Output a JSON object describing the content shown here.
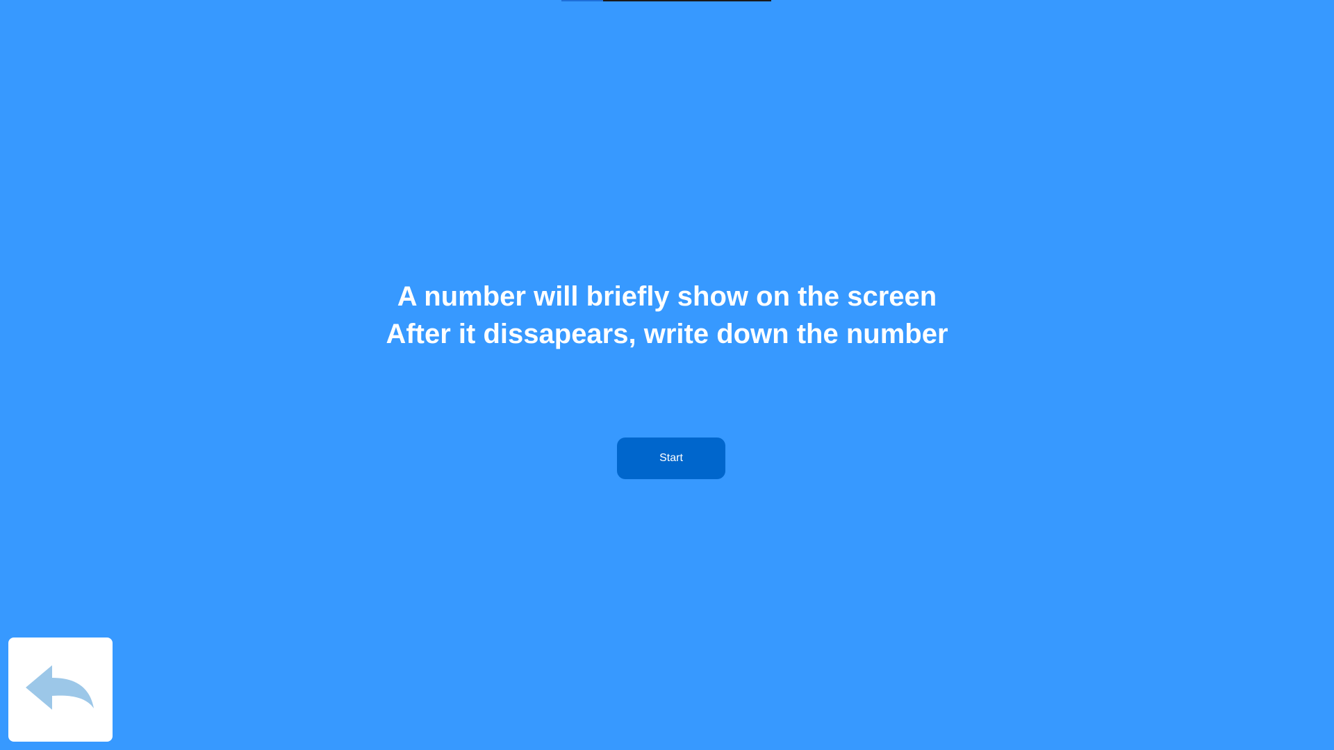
{
  "progress": {
    "fraction": 0.2
  },
  "instructions": {
    "line1": "A number will briefly show on the screen",
    "line2": "After it dissapears, write down the number"
  },
  "start_button": {
    "label": "Start"
  },
  "back_button": {
    "icon": "reply-arrow-icon"
  },
  "colors": {
    "background": "#3799ff",
    "button": "#0066cc",
    "text": "#ffffff",
    "back_icon": "#9cc7e8"
  }
}
